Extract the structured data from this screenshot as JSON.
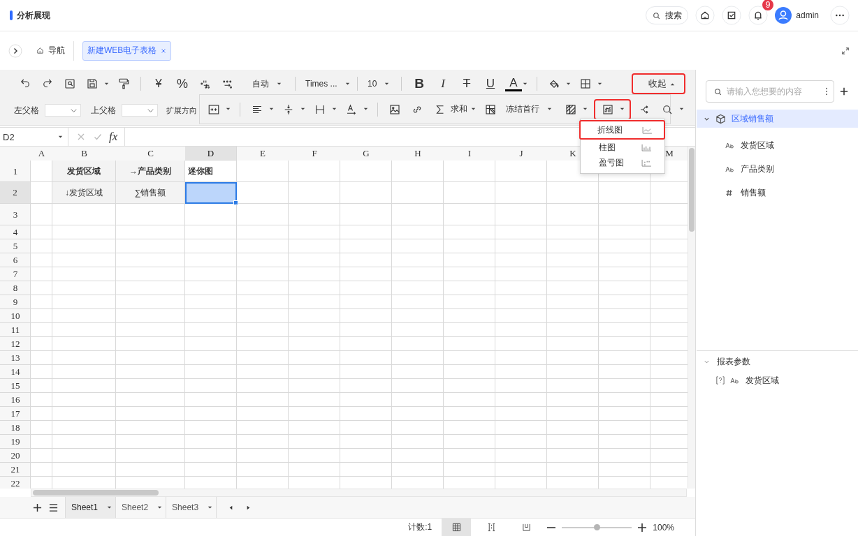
{
  "app": {
    "title": "分析展现"
  },
  "header": {
    "search": "搜索",
    "notification_count": "9",
    "user": "admin"
  },
  "tab_bar": {
    "nav": "导航",
    "tabs": [
      {
        "label": "新建WEB电子表格",
        "selected": true
      }
    ]
  },
  "toolbar": {
    "currency": "¥",
    "percent": "%",
    "number_format": "自动",
    "font": "Times ...",
    "font_size": "10",
    "format_buttons": [
      {
        "label": "B",
        "kind": "bold"
      },
      {
        "label": "I",
        "kind": "italic"
      },
      {
        "label": "T",
        "kind": "strike"
      },
      {
        "label": "U",
        "kind": "underline"
      }
    ],
    "font_color": "A",
    "collapse": {
      "label": "收起",
      "highlighted": true
    },
    "left_parent": "左父格",
    "top_parent": "上父格",
    "expand_direction": "扩展方向"
  },
  "floating_toolbar": {
    "sum": "求和",
    "freeze": "冻结首行",
    "chart_highlighted": true
  },
  "sparkline_menu": {
    "items": [
      {
        "label": "折线图",
        "kind": "line",
        "highlighted": true
      },
      {
        "label": "柱图",
        "kind": "column",
        "highlighted": false
      },
      {
        "label": "盈亏图",
        "kind": "winloss",
        "highlighted": false
      }
    ]
  },
  "formula_bar": {
    "cell_ref": "D2",
    "fx": "fx"
  },
  "sheet": {
    "columns": [
      {
        "label": "A",
        "selected": false
      },
      {
        "label": "B",
        "selected": false
      },
      {
        "label": "C",
        "selected": false
      },
      {
        "label": "D",
        "selected": true
      },
      {
        "label": "E",
        "selected": false
      },
      {
        "label": "F",
        "selected": false
      },
      {
        "label": "G",
        "selected": false
      },
      {
        "label": "H",
        "selected": false
      },
      {
        "label": "I",
        "selected": false
      },
      {
        "label": "J",
        "selected": false
      },
      {
        "label": "K",
        "selected": false
      },
      {},
      {
        "label": "M",
        "selected": false
      }
    ],
    "rows": [
      {
        "label": "1",
        "selected": false,
        "cells": [
          {},
          {
            "text": "发货区域",
            "bold": true,
            "shaded": true
          },
          {
            "text": "→产品类别",
            "bold": true,
            "shaded": true
          },
          {
            "text": "迷你图",
            "bold": true,
            "shaded": false
          }
        ]
      },
      {
        "label": "2",
        "selected": true,
        "cells": [
          {},
          {
            "text": "↓发货区域",
            "bold": false,
            "shaded": true
          },
          {
            "text": "∑销售额",
            "bold": false,
            "shaded": true
          },
          {
            "selected": true
          }
        ]
      },
      {
        "label": "3"
      },
      {
        "label": "4"
      },
      {
        "label": "5"
      },
      {
        "label": "6"
      },
      {
        "label": "7"
      },
      {
        "label": "8"
      },
      {
        "label": "9"
      },
      {
        "label": "10"
      },
      {
        "label": "11"
      },
      {
        "label": "12"
      },
      {
        "label": "13"
      },
      {
        "label": "14"
      },
      {
        "label": "15"
      },
      {
        "label": "16"
      },
      {
        "label": "17"
      },
      {
        "label": "18"
      },
      {
        "label": "19"
      },
      {
        "label": "20"
      },
      {
        "label": "21"
      },
      {
        "label": "22"
      }
    ]
  },
  "sheet_tabs": [
    {
      "label": "Sheet1",
      "selected": true
    },
    {
      "label": "Sheet2",
      "selected": false
    },
    {
      "label": "Sheet3",
      "selected": false
    }
  ],
  "status_bar": {
    "count": "计数:1",
    "views": [
      {
        "kind": "normal",
        "selected": true
      },
      {
        "kind": "page_break",
        "selected": false
      },
      {
        "kind": "page_layout",
        "selected": false
      }
    ],
    "zoom": {
      "level": 0.5,
      "reading": "100%"
    }
  },
  "side_panel": {
    "search": {
      "placeholder": "请输入您想要的内容"
    },
    "datasets": [
      {
        "label": "区域销售额",
        "expanded": true,
        "selected": true,
        "children": [
          {
            "label": "发货区域",
            "kind": "text"
          },
          {
            "label": "产品类别",
            "kind": "text"
          },
          {
            "label": "销售额",
            "kind": "number"
          }
        ]
      }
    ],
    "params": {
      "title": "报表参数",
      "expanded": true,
      "items": [
        {
          "label": "发货区域",
          "kind": "text"
        }
      ]
    }
  }
}
